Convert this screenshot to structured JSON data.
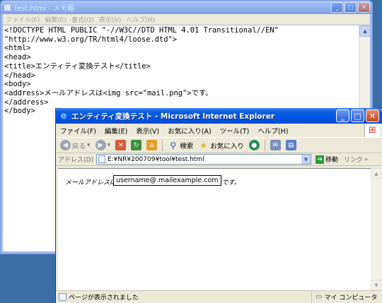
{
  "notepad": {
    "title": "test.html - メモ帳",
    "menu": [
      "ファイル(F)",
      "編集(E)",
      "書式(O)",
      "表示(V)",
      "ヘルプ(H)"
    ],
    "lines": [
      "<!DOCTYPE HTML PUBLIC \"-//W3C//DTD HTML 4.01 Transitional//EN\"",
      "\"http://www.w3.org/TR/html4/loose.dtd\">",
      "<html>",
      "<head>",
      "<title>エンティティ変換テスト</title>",
      "</head>",
      "<body>",
      "<address>メールアドレスは<img src=\"mail.png\">です。",
      "</address>",
      "</body>"
    ]
  },
  "ie": {
    "title": "エンティティ変換テスト - Microsoft Internet Explorer",
    "menu": [
      "ファイル(F)",
      "編集(E)",
      "表示(V)",
      "お気に入り(A)",
      "ツール(T)",
      "ヘルプ(H)"
    ],
    "toolbar": {
      "back": "戻る",
      "search": "検索",
      "favorites": "お気に入り"
    },
    "address": {
      "label": "アドレス(D)",
      "value": "E:¥NR¥200709¥tool¥test.html",
      "go": "移動",
      "links": "リンク"
    },
    "content": {
      "before": "メールアドレスは",
      "tooltip": "username@.mailexample.com",
      "after": "です。"
    },
    "status": {
      "text": "ページが表示されました",
      "zone": "マイ コンピュータ"
    }
  }
}
